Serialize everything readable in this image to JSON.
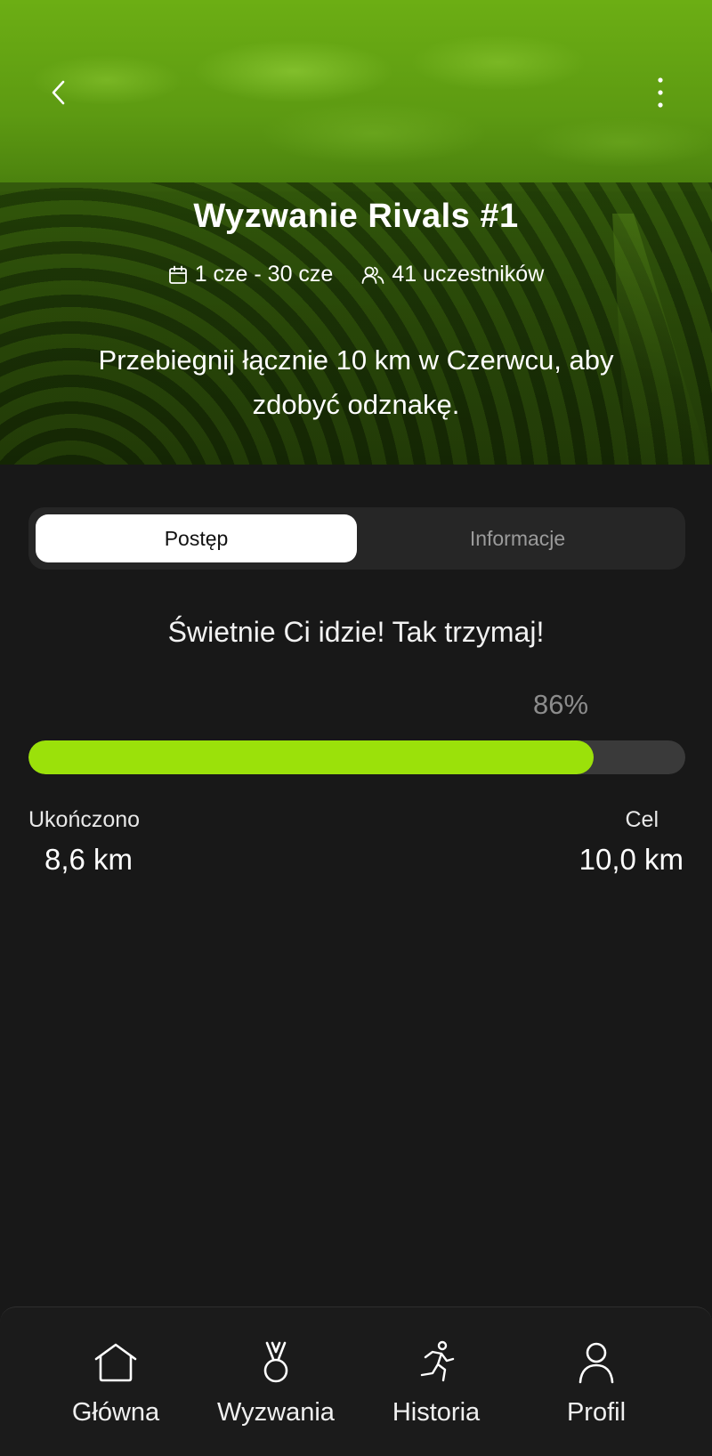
{
  "hero": {
    "title": "Wyzwanie Rivals #1",
    "dates": "1 cze - 30 cze",
    "participants": "41 uczestników",
    "description": "Przebiegnij łącznie 10 km w Czerwcu, aby zdobyć odznakę."
  },
  "tabs": [
    {
      "label": "Postęp",
      "active": true
    },
    {
      "label": "Informacje",
      "active": false
    }
  ],
  "progress": {
    "message": "Świetnie Ci idzie! Tak trzymaj!",
    "percent_label": "86%",
    "fraction": 0.86,
    "completed_label": "Ukończono",
    "completed_value": "8,6 km",
    "goal_label": "Cel",
    "goal_value": "10,0 km"
  },
  "colors": {
    "accent": "#9be10a",
    "background": "#181818",
    "hero_tint": "#4f8710"
  },
  "nav": {
    "items": [
      {
        "label": "Główna",
        "icon": "home-icon"
      },
      {
        "label": "Wyzwania",
        "icon": "medal-icon"
      },
      {
        "label": "Historia",
        "icon": "running-icon"
      },
      {
        "label": "Profil",
        "icon": "user-icon"
      }
    ]
  }
}
